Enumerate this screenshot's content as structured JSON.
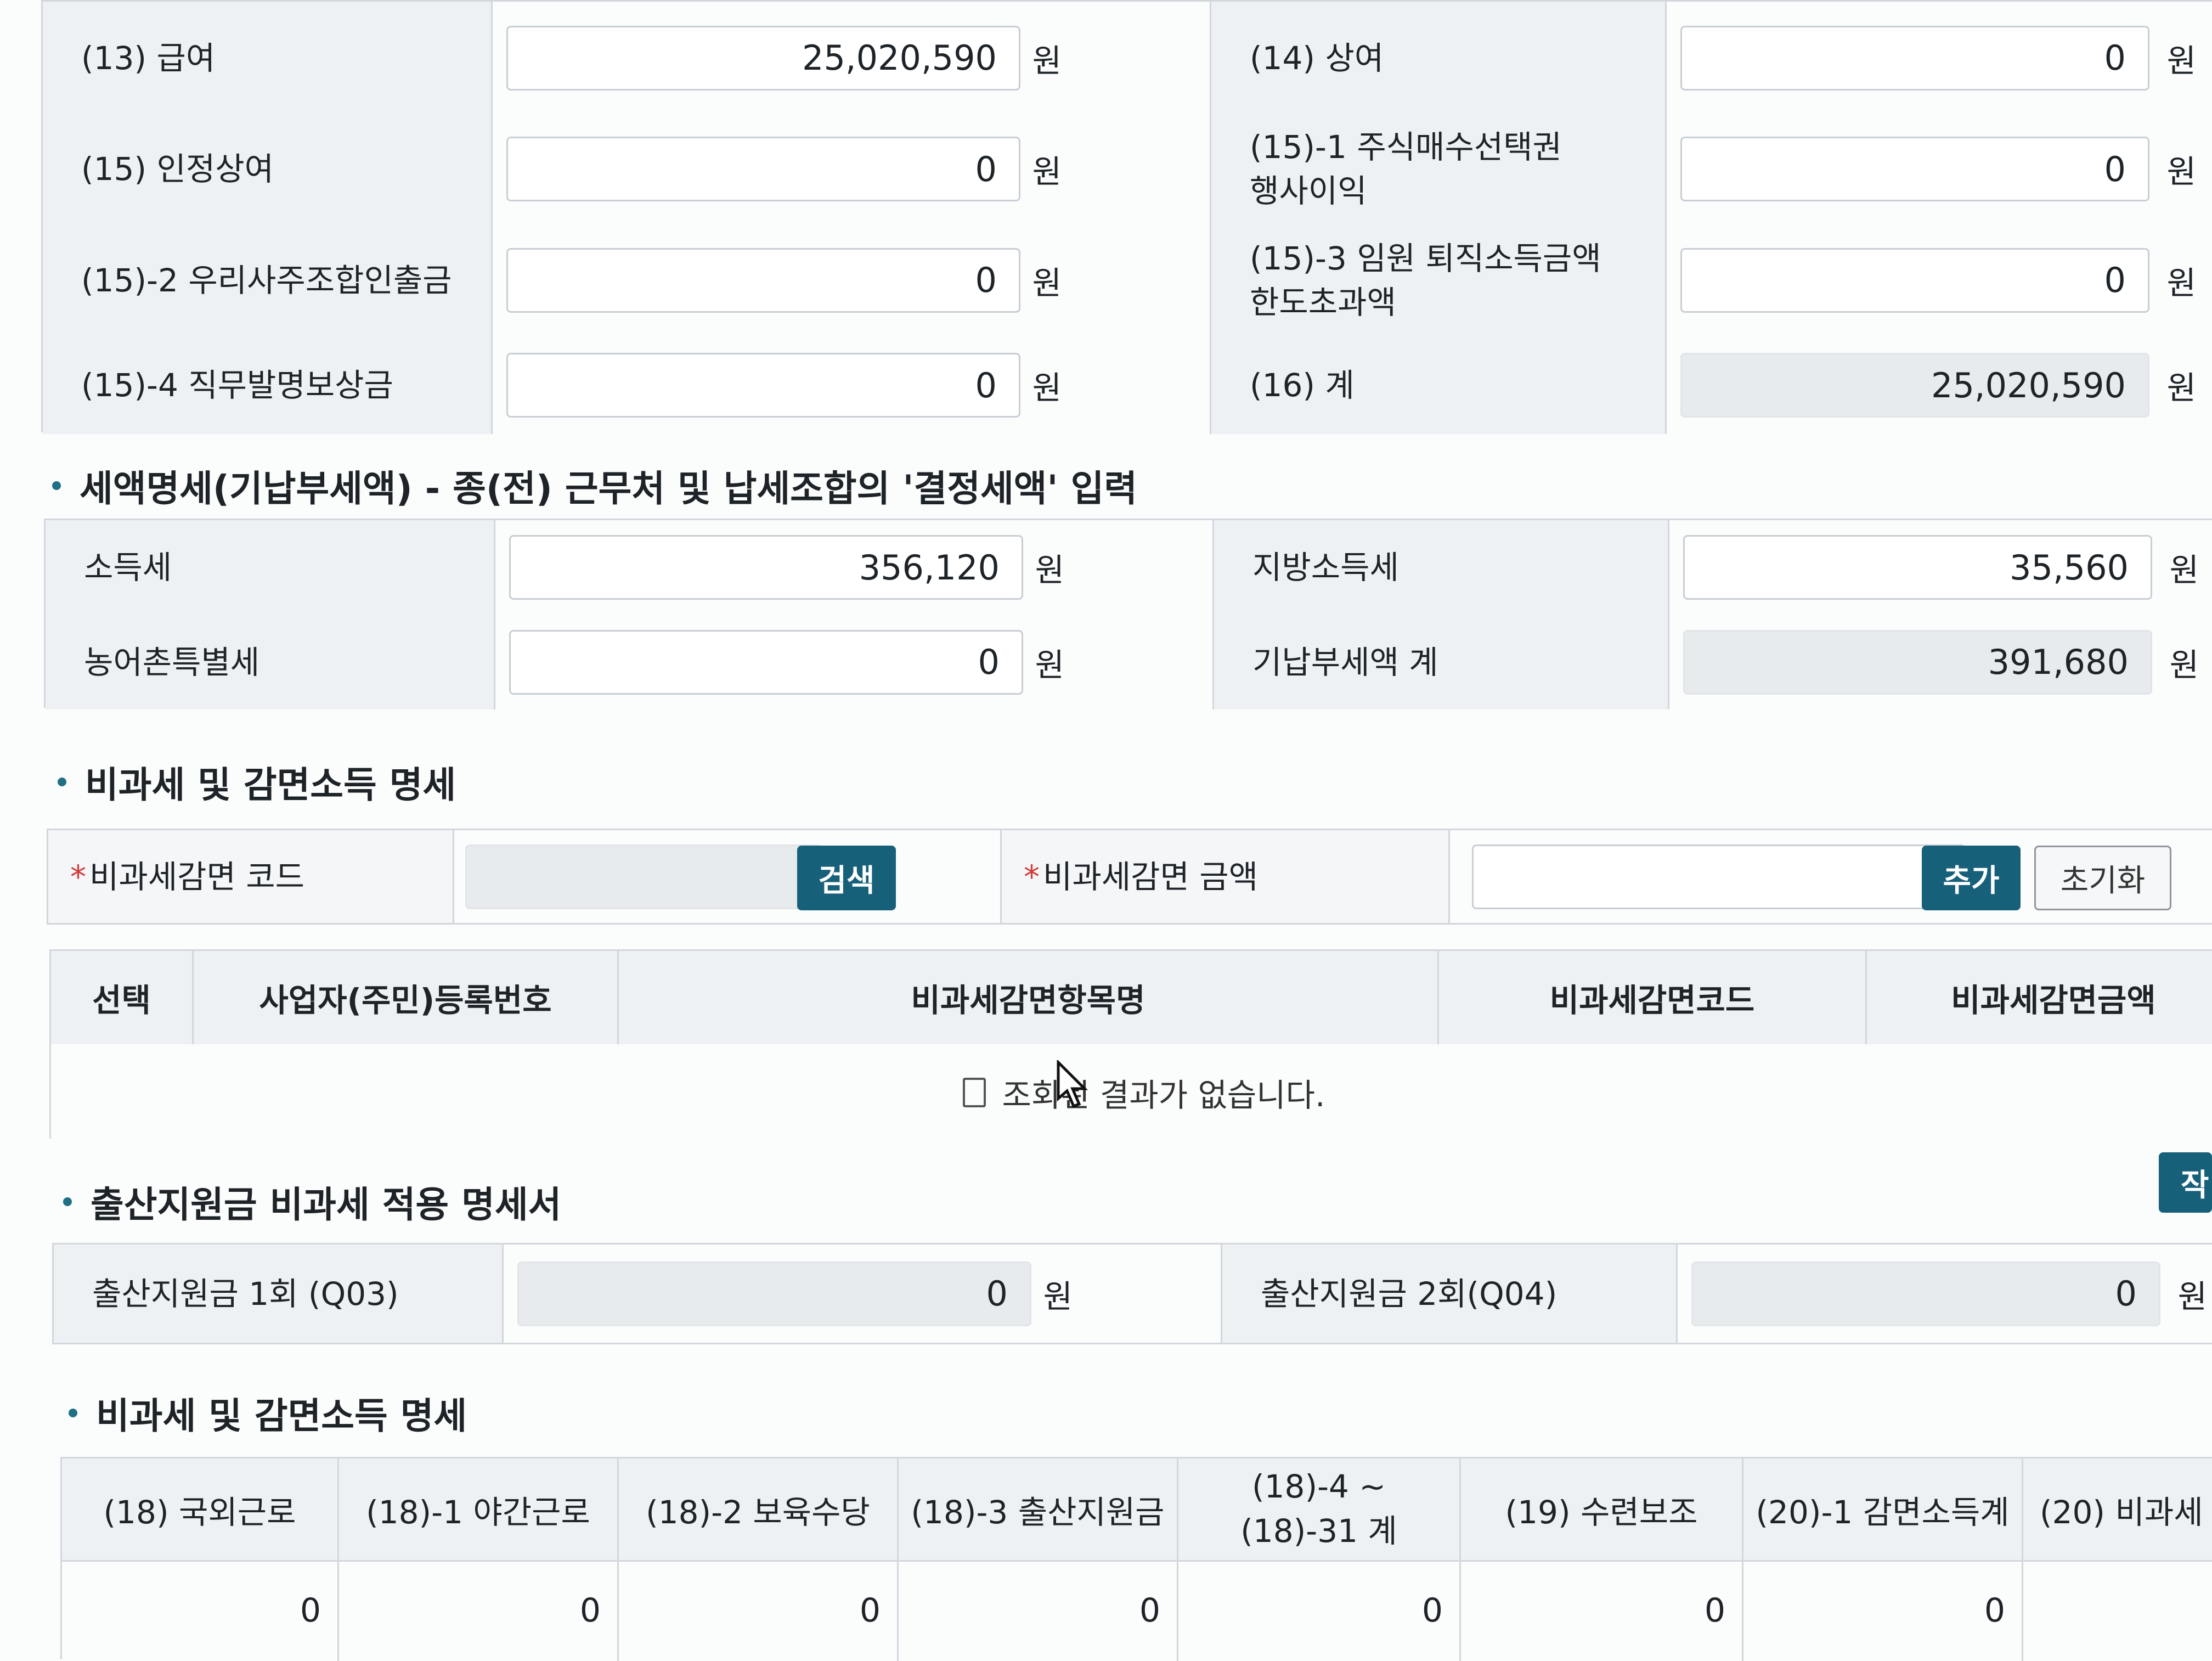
{
  "income": {
    "rows": [
      {
        "l1": "(13) 급여",
        "v1": "25,020,590",
        "l2": "(14) 상여",
        "v2": "0"
      },
      {
        "l1": "(15) 인정상여",
        "v1": "0",
        "l2a": "(15)-1 주식매수선택권",
        "l2b": "행사이익",
        "v2": "0"
      },
      {
        "l1": "(15)-2 우리사주조합인출금",
        "v1": "0",
        "l2a": "(15)-3 임원 퇴직소득금액",
        "l2b": "한도초과액",
        "v2": "0"
      },
      {
        "l1": "(15)-4 직무발명보상금",
        "v1": "0",
        "l2": "(16) 계",
        "v2": "25,020,590"
      }
    ],
    "unit": "원"
  },
  "tax": {
    "title": "세액명세(기납부세액) - 종(전) 근무처 및 납세조합의 '결정세액' 입력",
    "income_tax_label": "소득세",
    "income_tax": "356,120",
    "local_tax_label": "지방소득세",
    "local_tax": "35,560",
    "rural_tax_label": "농어촌특별세",
    "rural_tax": "0",
    "total_label": "기납부세액 계",
    "total": "391,680"
  },
  "nontax": {
    "title": "비과세 및 감면소득 명세",
    "code_label": "비과세감면 코드",
    "search_btn": "검색",
    "amount_label": "비과세감면 금액",
    "add_btn": "추가",
    "reset_btn": "초기화",
    "columns": [
      "선택",
      "사업자(주민)등록번호",
      "비과세감면항목명",
      "비과세감면코드",
      "비과세감면금액"
    ],
    "empty": "조회된 결과가 없습니다."
  },
  "birth": {
    "title": "출산지원금 비과세 적용 명세서",
    "btn": "작",
    "q03_label": "출산지원금 1회 (Q03)",
    "q03": "0",
    "q04_label": "출산지원금 2회(Q04)",
    "q04": "0"
  },
  "summary": {
    "title": "비과세 및 감면소득 명세",
    "headers": [
      "(18) 국외근로",
      "(18)-1 야간근로",
      "(18)-2 보육수당",
      "(18)-3 출산지원금",
      "(18)-4 ~",
      "(18)-31 계",
      "(19) 수련보조",
      "(20)-1 감면소득계",
      "(20) 비과세"
    ],
    "values": [
      "0",
      "0",
      "0",
      "0",
      "0",
      "0",
      "0",
      ""
    ]
  },
  "colors": {
    "primary": "#17607a",
    "label_bg": "#eef1f4",
    "border": "#d2d7dc"
  }
}
